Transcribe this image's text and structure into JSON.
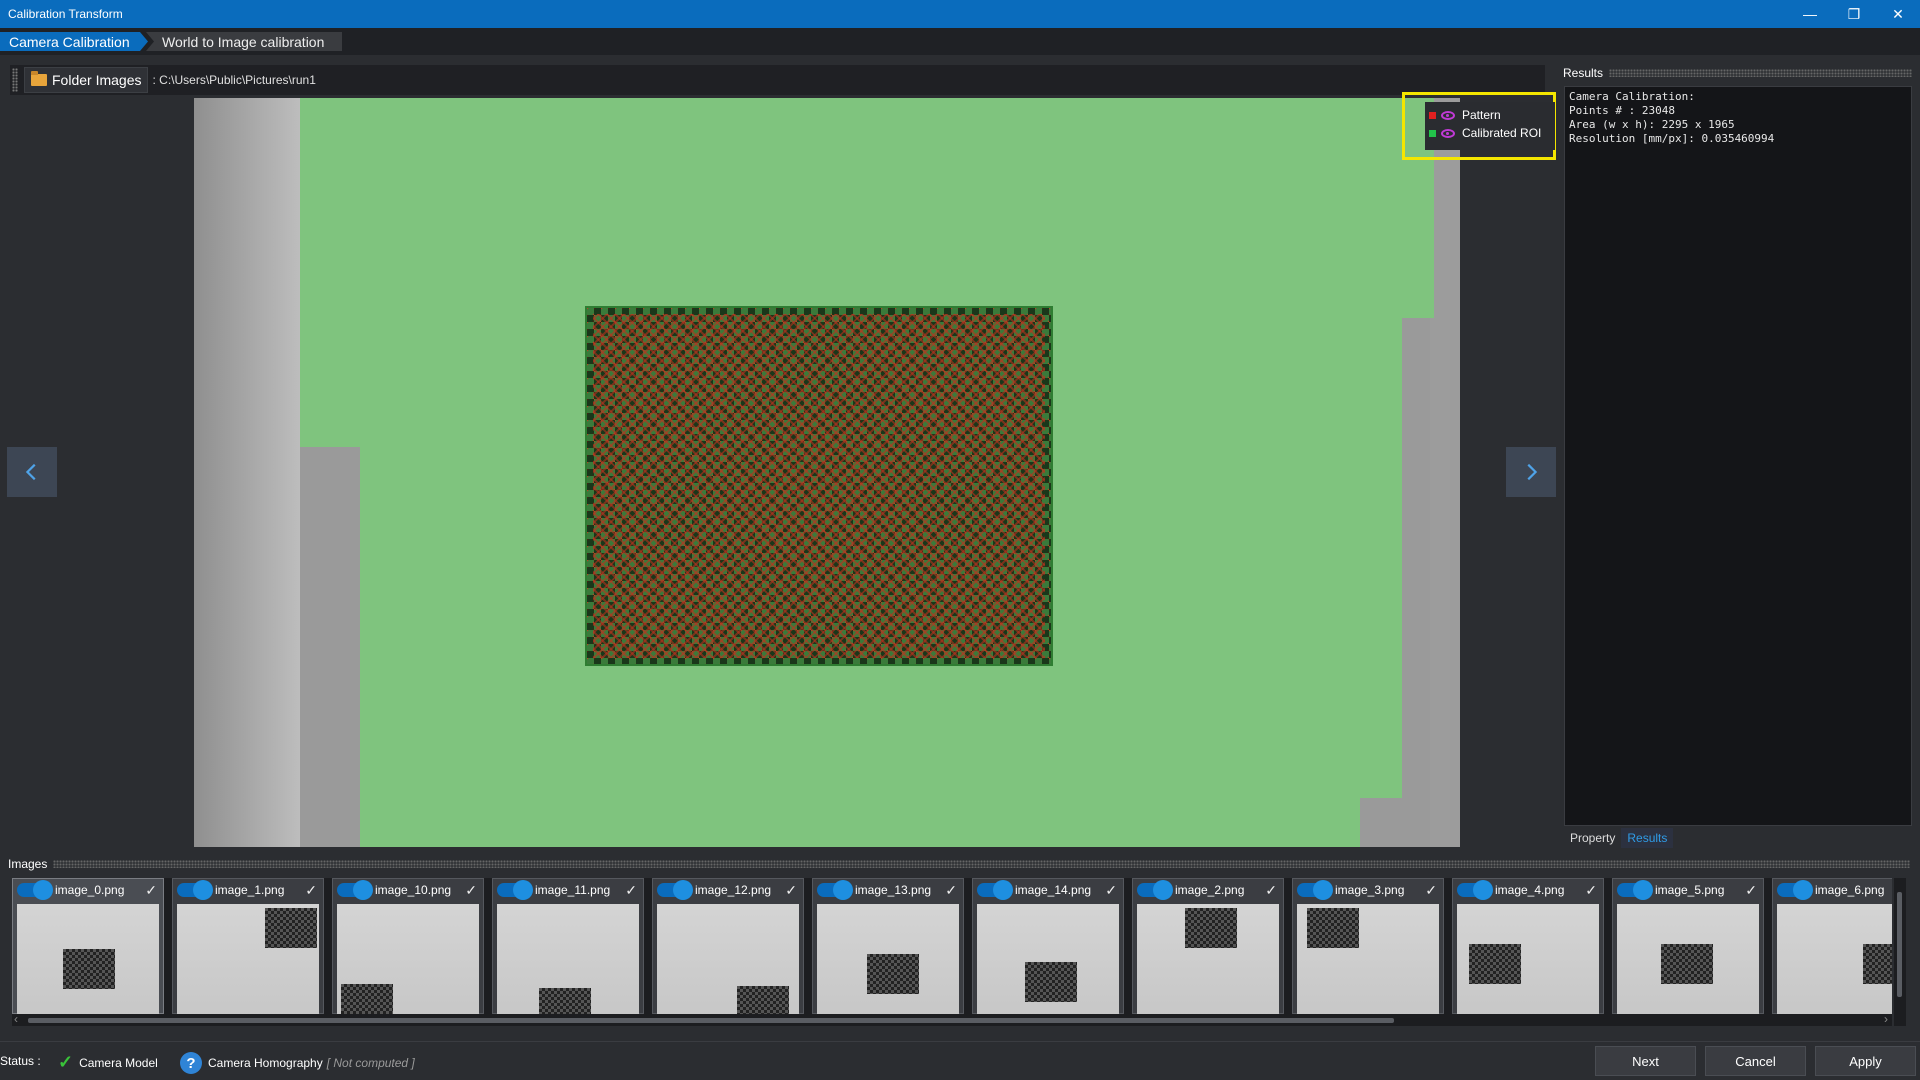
{
  "window": {
    "title": "Calibration Transform"
  },
  "tabs": [
    {
      "label": "Camera Calibration"
    },
    {
      "label": "World to Image calibration"
    }
  ],
  "toolbar": {
    "folder_button": "Folder Images",
    "path": ": C:\\Users\\Public\\Pictures\\run1"
  },
  "legend": {
    "items": [
      {
        "label": "Pattern",
        "color": "#e02020"
      },
      {
        "label": "Calibrated ROI",
        "color": "#22c24a"
      }
    ]
  },
  "results": {
    "title": "Results",
    "lines": [
      "Camera Calibration:",
      "Points # : 23048",
      "",
      "Area (w x h): 2295 x 1965",
      "Resolution [mm/px]: 0.035460994"
    ],
    "tabs": [
      {
        "label": "Property"
      },
      {
        "label": "Results"
      }
    ]
  },
  "images": {
    "title": "Images",
    "items": [
      {
        "name": "image_0.png"
      },
      {
        "name": "image_1.png"
      },
      {
        "name": "image_10.png"
      },
      {
        "name": "image_11.png"
      },
      {
        "name": "image_12.png"
      },
      {
        "name": "image_13.png"
      },
      {
        "name": "image_14.png"
      },
      {
        "name": "image_2.png"
      },
      {
        "name": "image_3.png"
      },
      {
        "name": "image_4.png"
      },
      {
        "name": "image_5.png"
      },
      {
        "name": "image_6.png"
      }
    ]
  },
  "status": {
    "label": "Status :",
    "camera_model": "Camera Model",
    "camera_homography": "Camera Homography",
    "homography_state": "[ Not computed ]"
  },
  "buttons": {
    "next": "Next",
    "cancel": "Cancel",
    "apply": "Apply"
  }
}
